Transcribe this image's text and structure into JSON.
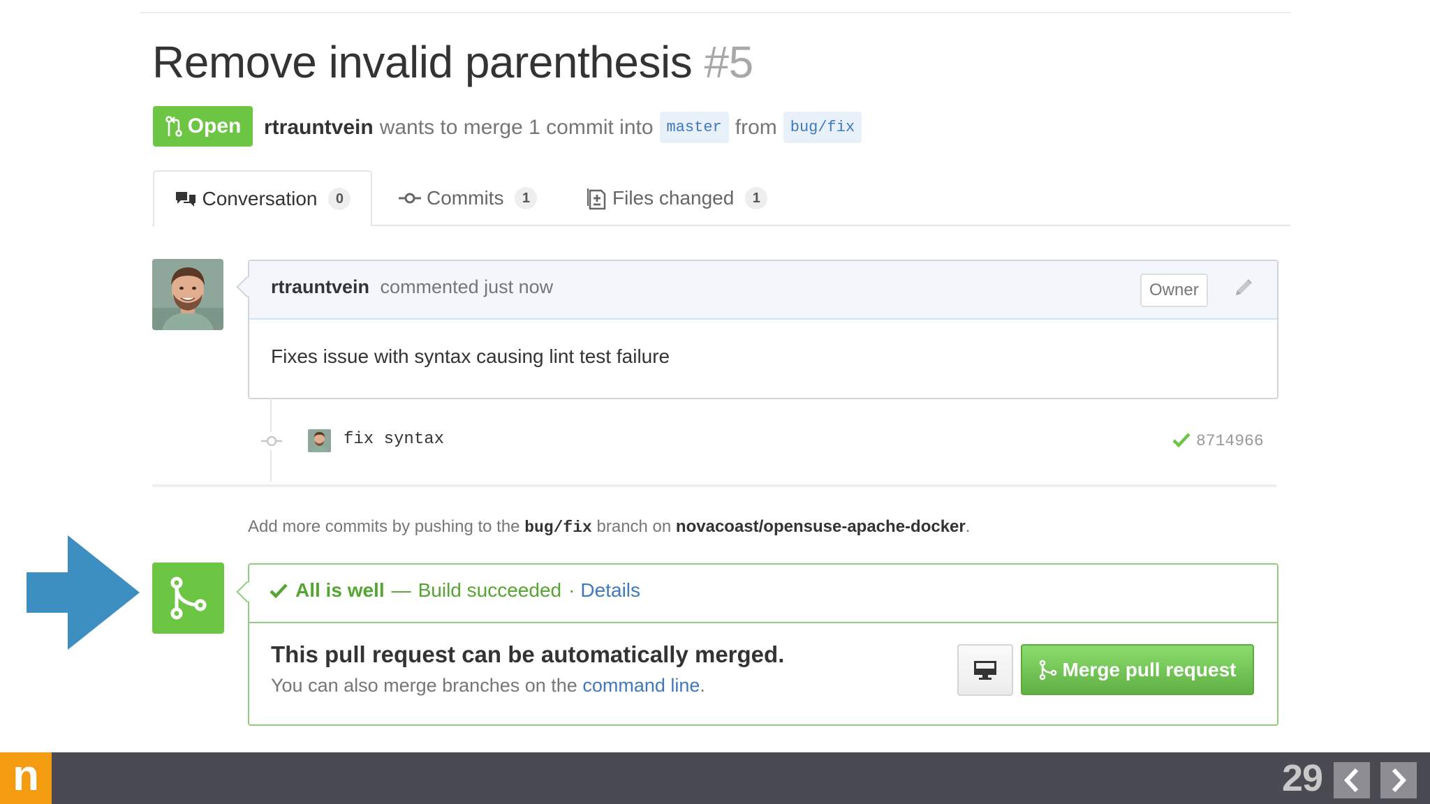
{
  "title": {
    "text": "Remove invalid parenthesis",
    "number": "#5"
  },
  "state_badge": {
    "label": "Open",
    "color": "#6cc644"
  },
  "meta": {
    "author": "rtrauntvein",
    "text_before": "wants to merge 1 commit into",
    "base_branch": "master",
    "text_middle": "from",
    "head_branch": "bug/fix"
  },
  "tabs": [
    {
      "label": "Conversation",
      "count": "0",
      "icon": "comment-discussion-icon",
      "selected": true
    },
    {
      "label": "Commits",
      "count": "1",
      "icon": "git-commit-icon",
      "selected": false
    },
    {
      "label": "Files changed",
      "count": "1",
      "icon": "diff-icon",
      "selected": false
    }
  ],
  "comment": {
    "author": "rtrauntvein",
    "action": "commented just now",
    "role_label": "Owner",
    "body": "Fixes issue with syntax causing lint test failure",
    "edit_icon": "pencil-icon"
  },
  "commit": {
    "message": "fix syntax",
    "sha": "8714966",
    "status_icon": "check-icon"
  },
  "push_note": {
    "prefix": "Add more commits by pushing to the",
    "branch": "bug/fix",
    "middle": "branch on",
    "repo": "novacoast/opensuse-apache-docker",
    "suffix": "."
  },
  "merge": {
    "status_title": "All is well",
    "status_dash": "—",
    "status_desc": "Build succeeded",
    "status_separator": "·",
    "details_link": "Details",
    "heading": "This pull request can be automatically merged.",
    "sub_prefix": "You can also merge branches on the",
    "sub_link": "command line",
    "sub_suffix": ".",
    "button_label": "Merge pull request"
  },
  "slide": {
    "number": "29",
    "logo_letter": "n"
  },
  "colors": {
    "accent_green": "#6cc644",
    "link_blue": "#4078c0",
    "arrow_blue": "#3d8ec1",
    "logo_orange": "#f39c12",
    "bottom_bar": "#4a4a52"
  }
}
